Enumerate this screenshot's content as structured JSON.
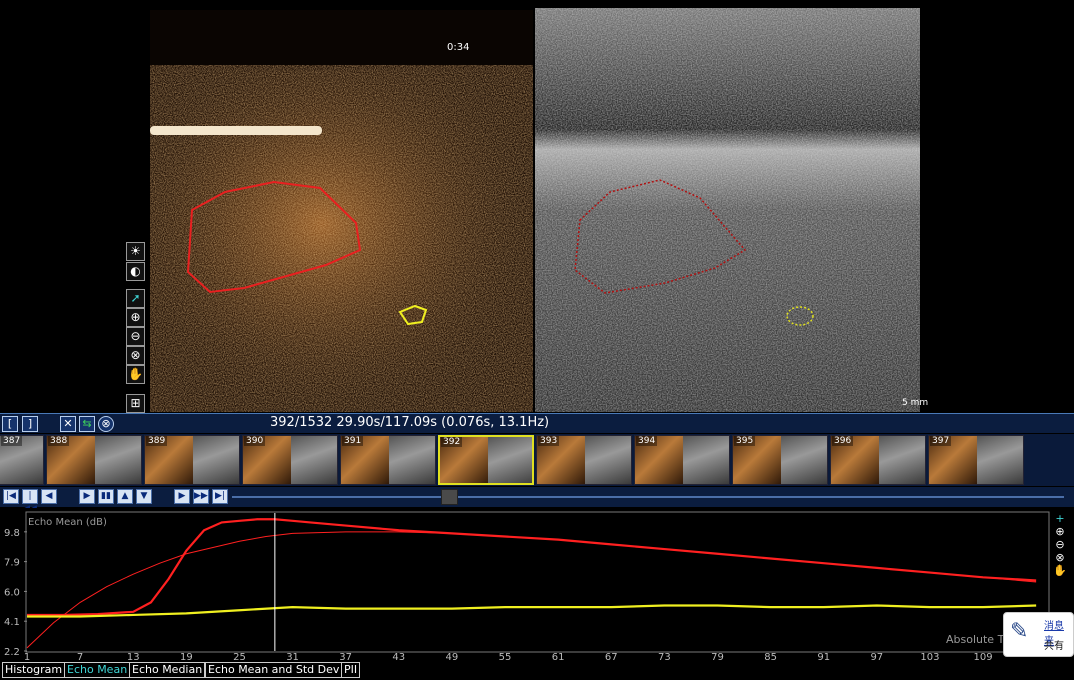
{
  "viewer": {
    "timer": "0:34",
    "scale_label": "5 mm"
  },
  "frame_info": "392/1532  29.90s/117.09s (0.076s, 13.1Hz)",
  "thumbnails": [
    "387",
    "388",
    "389",
    "390",
    "391",
    "392",
    "393",
    "394",
    "395",
    "396",
    "397"
  ],
  "selected_thumbnail": "392",
  "chart_data": {
    "type": "line",
    "title": "Echo Mean (dB)",
    "yticks": [
      "9.8",
      "7.9",
      "6.0",
      "4.1",
      "2.2"
    ],
    "ytick_values": [
      9.8,
      7.9,
      6.0,
      4.1,
      2.2
    ],
    "ylim": [
      2.2,
      11.0
    ],
    "xticks": [
      "1",
      "7",
      "13",
      "19",
      "25",
      "31",
      "37",
      "43",
      "49",
      "55",
      "61",
      "67",
      "73",
      "79",
      "85",
      "91",
      "97",
      "103",
      "109"
    ],
    "xlim": [
      1,
      116
    ],
    "cursor_x": 29,
    "corner_label": "Absolute Ti",
    "series": [
      {
        "color": "#ff2020",
        "x": [
          1,
          5,
          9,
          13,
          15,
          17,
          19,
          21,
          23,
          25,
          27,
          29,
          31,
          33,
          37,
          43,
          49,
          55,
          61,
          67,
          73,
          79,
          85,
          91,
          97,
          103,
          109,
          115
        ],
        "values": [
          4.5,
          4.5,
          4.55,
          4.7,
          5.3,
          6.8,
          8.6,
          9.9,
          10.4,
          10.5,
          10.6,
          10.6,
          10.5,
          10.4,
          10.2,
          9.9,
          9.7,
          9.5,
          9.3,
          9.0,
          8.7,
          8.4,
          8.1,
          7.8,
          7.5,
          7.2,
          6.9,
          6.7
        ]
      },
      {
        "color": "#ff2020",
        "x": [
          1,
          4,
          7,
          10,
          13,
          16,
          19,
          22,
          25,
          28,
          31,
          37,
          43,
          49,
          55,
          61,
          67,
          73,
          79,
          85,
          91,
          97,
          103,
          109,
          115
        ],
        "values": [
          2.4,
          4.0,
          5.3,
          6.3,
          7.1,
          7.8,
          8.4,
          8.8,
          9.2,
          9.5,
          9.7,
          9.8,
          9.8,
          9.7,
          9.5,
          9.3,
          9.0,
          8.7,
          8.4,
          8.1,
          7.8,
          7.5,
          7.2,
          6.9,
          6.6
        ]
      },
      {
        "color": "#f0f020",
        "x": [
          1,
          7,
          13,
          19,
          25,
          31,
          37,
          43,
          49,
          55,
          61,
          67,
          73,
          79,
          85,
          91,
          97,
          103,
          109,
          115
        ],
        "values": [
          4.4,
          4.4,
          4.5,
          4.6,
          4.8,
          5.0,
          4.9,
          4.9,
          4.9,
          5.0,
          5.0,
          5.0,
          5.1,
          5.1,
          5.0,
          5.0,
          5.1,
          5.0,
          5.0,
          5.1
        ]
      }
    ]
  },
  "tabs": [
    "Histogram",
    "Echo Mean",
    "Echo Median",
    "Echo Mean and Std Dev",
    "PII"
  ],
  "active_tab": "Echo Mean",
  "notification": {
    "title": "消息来",
    "body": "共有"
  },
  "icons": {
    "brightness": "sun-icon",
    "contrast": "contrast-icon",
    "pointer": "pointer-icon",
    "zoom_in": "zoom-in-icon",
    "zoom_out": "zoom-out-icon",
    "zoom_reset": "zoom-reset-icon",
    "pan": "pan-hand-icon"
  }
}
